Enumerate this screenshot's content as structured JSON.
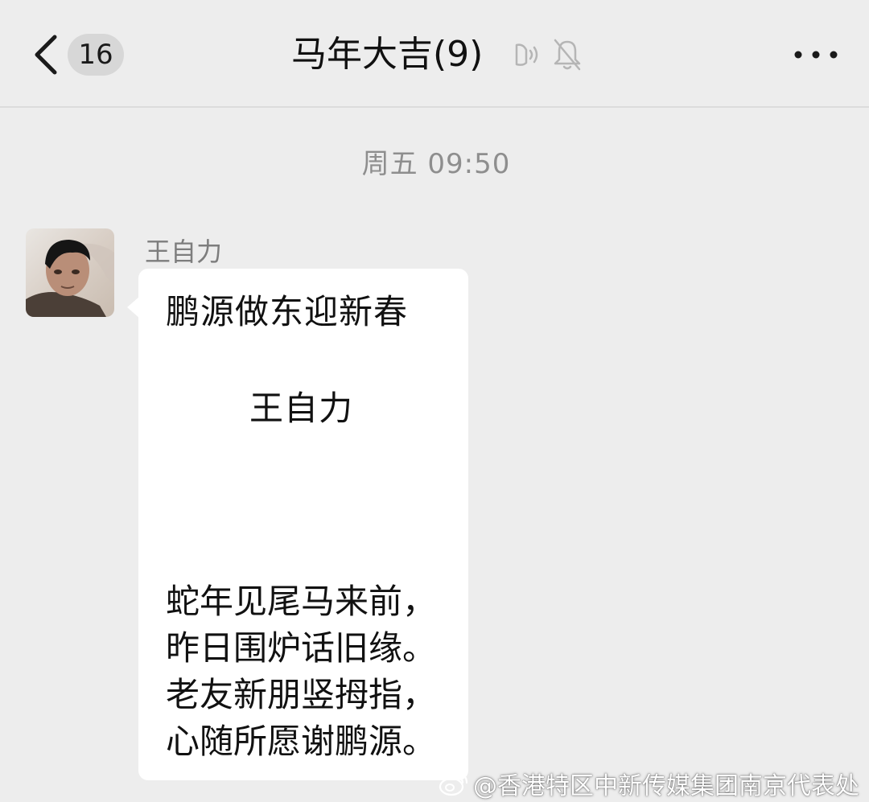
{
  "header": {
    "unread_count": "16",
    "title": "马年大吉(9)",
    "icons": [
      "chevron-left-icon",
      "voice-icon",
      "bell-muted-icon",
      "more-dots-icon"
    ]
  },
  "timestamp": "周五 09:50",
  "message": {
    "sender": "王自力",
    "title": "鹏源做东迎新春",
    "author": "王自力",
    "lines": [
      "蛇年见尾马来前，",
      "昨日围炉话旧缘。",
      "老友新朋竖拇指，",
      "心随所愿谢鹏源。"
    ]
  },
  "watermark": {
    "text": "@香港特区中新传媒集团南京代表处",
    "icon": "weibo-icon"
  },
  "colors": {
    "background": "#ededed",
    "bubble": "#ffffff",
    "badge": "#d7d7d7",
    "muted_text": "#8e8e8e"
  }
}
